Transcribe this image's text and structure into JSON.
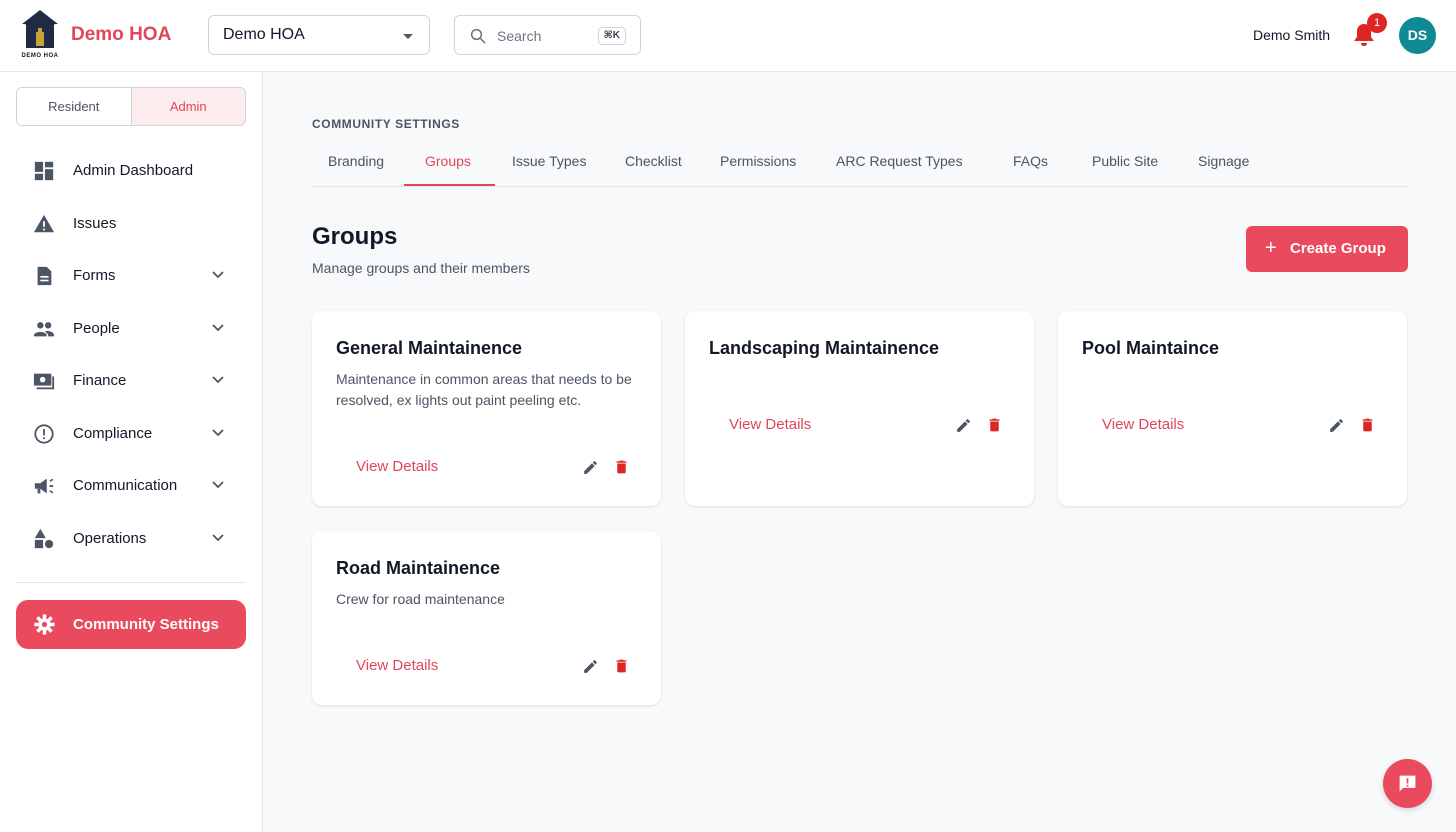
{
  "header": {
    "logo_text": "DEMO HOA",
    "brand": "Demo HOA",
    "hoa_select": "Demo HOA",
    "search_placeholder": "Search",
    "search_shortcut": "⌘K",
    "user_name": "Demo Smith",
    "notification_count": "1",
    "avatar_initials": "DS"
  },
  "sidebar": {
    "toggle": {
      "resident": "Resident",
      "admin": "Admin"
    },
    "items": [
      {
        "label": "Admin Dashboard",
        "icon": "dashboard-icon"
      },
      {
        "label": "Issues",
        "icon": "warning-icon"
      },
      {
        "label": "Forms",
        "icon": "document-icon"
      },
      {
        "label": "People",
        "icon": "people-icon"
      },
      {
        "label": "Finance",
        "icon": "money-icon"
      },
      {
        "label": "Compliance",
        "icon": "alert-circle-icon"
      },
      {
        "label": "Communication",
        "icon": "megaphone-icon"
      },
      {
        "label": "Operations",
        "icon": "shapes-icon"
      }
    ],
    "settings_label": "Community Settings"
  },
  "main": {
    "eyebrow": "COMMUNITY SETTINGS",
    "tabs": [
      "Branding",
      "Groups",
      "Issue Types",
      "Checklist",
      "Permissions",
      "ARC Request Types",
      "FAQs",
      "Public Site",
      "Signage"
    ],
    "active_tab": "Groups",
    "title": "Groups",
    "subtitle": "Manage groups and their members",
    "create_button": "Create Group",
    "groups": [
      {
        "name": "General Maintainence",
        "description": "Maintenance in common areas that needs to be resolved, ex lights out paint peeling etc.",
        "action": "View Details"
      },
      {
        "name": "Landscaping Maintainence",
        "description": "",
        "action": "View Details"
      },
      {
        "name": "Pool Maintaince",
        "description": "",
        "action": "View Details"
      },
      {
        "name": "Road Maintainence",
        "description": "Crew for road maintenance",
        "action": "View Details"
      }
    ]
  },
  "colors": {
    "accent": "#e94a5e",
    "accent_text": "#e1475a",
    "danger": "#dc2626",
    "avatar": "#0f8a94"
  }
}
